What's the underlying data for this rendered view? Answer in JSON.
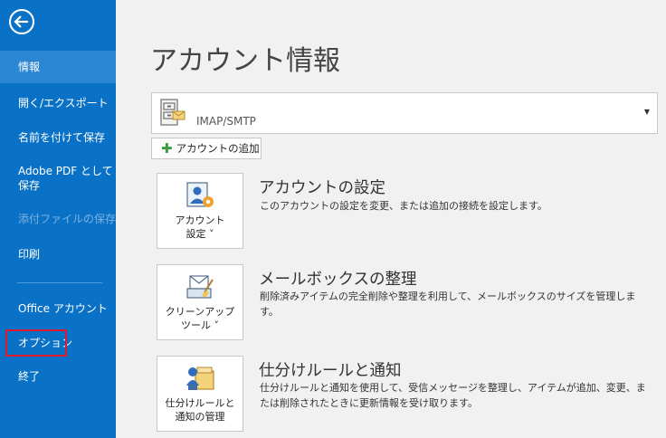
{
  "sidebar": {
    "items": [
      {
        "label": "情報"
      },
      {
        "label": "開く/エクスポート"
      },
      {
        "label": "名前を付けて保存"
      },
      {
        "label_line1": "Adobe PDF として",
        "label_line2": "保存"
      },
      {
        "label": "添付ファイルの保存"
      },
      {
        "label": "印刷"
      },
      {
        "label": "Office アカウント"
      },
      {
        "label": "オプション"
      },
      {
        "label": "終了"
      }
    ]
  },
  "main": {
    "title": "アカウント情報",
    "account": {
      "type": "IMAP/SMTP"
    },
    "add_account_label": "アカウントの追加",
    "sections": [
      {
        "tile_line1": "アカウント",
        "tile_line2": "設定 ˅",
        "title": "アカウントの設定",
        "desc": "このアカウントの設定を変更、または追加の接続を設定します。"
      },
      {
        "tile_line1": "クリーンアップ",
        "tile_line2": "ツール ˅",
        "title": "メールボックスの整理",
        "desc": "削除済みアイテムの完全削除や整理を利用して、メールボックスのサイズを管理します。"
      },
      {
        "tile_line1": "仕分けルールと",
        "tile_line2": "通知の管理",
        "title": "仕分けルールと通知",
        "desc": "仕分けルールと通知を使用して、受信メッセージを整理し、アイテムが追加、変更、または削除されたときに更新情報を受け取ります。"
      }
    ]
  },
  "colors": {
    "sidebar_bg": "#0a72c6",
    "sidebar_selected": "#2b87d3",
    "highlight_border": "#e1182a"
  }
}
